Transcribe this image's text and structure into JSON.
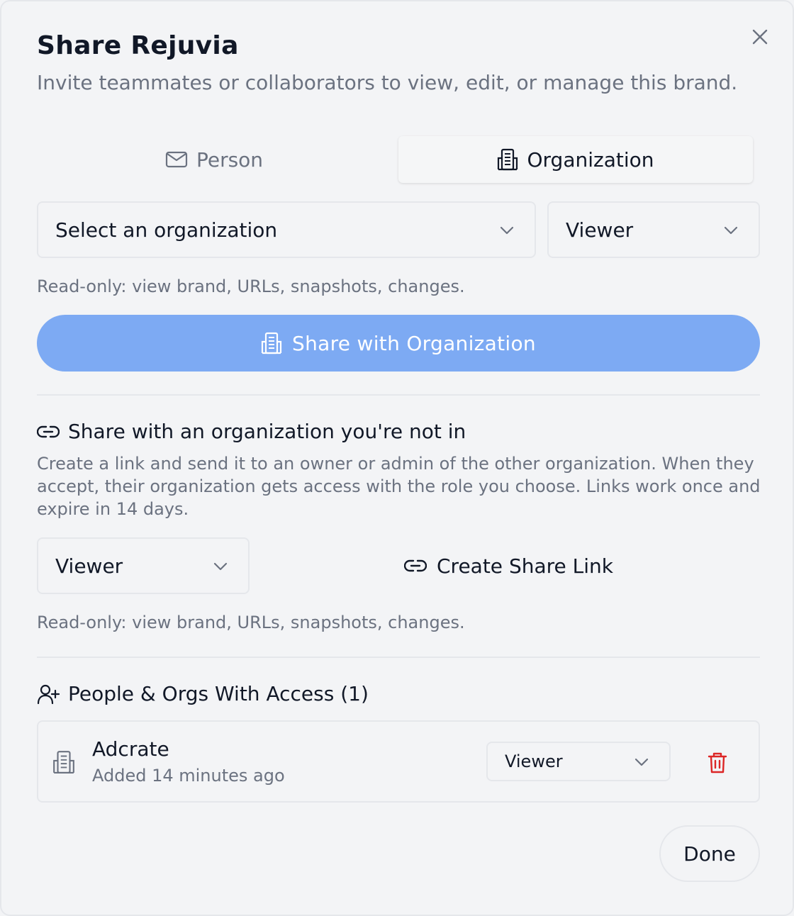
{
  "dialog": {
    "title": "Share Rejuvia",
    "subtitle": "Invite teammates or collaborators to view, edit, or manage this brand.",
    "close_icon": "close-icon"
  },
  "tabs": [
    {
      "label": "Person",
      "icon": "mail-icon",
      "active": false
    },
    {
      "label": "Organization",
      "icon": "building-icon",
      "active": true
    }
  ],
  "org_form": {
    "org_select_value": "Select an organization",
    "role_select_value": "Viewer",
    "role_hint": "Read-only: view brand, URLs, snapshots, changes.",
    "share_button_label": "Share with Organization"
  },
  "link_section": {
    "heading": "Share with an organization you're not in",
    "description": "Create a link and send it to an owner or admin of the other organization. When they accept, their organization gets access with the role you choose. Links work once and expire in 14 days.",
    "role_select_value": "Viewer",
    "create_link_label": "Create Share Link",
    "role_hint": "Read-only: view brand, URLs, snapshots, changes."
  },
  "access_section": {
    "heading": "People & Orgs With Access (1)",
    "entries": [
      {
        "name": "Adcrate",
        "added": "Added 14 minutes ago",
        "role": "Viewer"
      }
    ]
  },
  "footer": {
    "done_label": "Done"
  },
  "colors": {
    "primary_button": "#7daaf3",
    "delete": "#dc2626",
    "muted_text": "#6b7280",
    "border": "#e5e7eb"
  }
}
